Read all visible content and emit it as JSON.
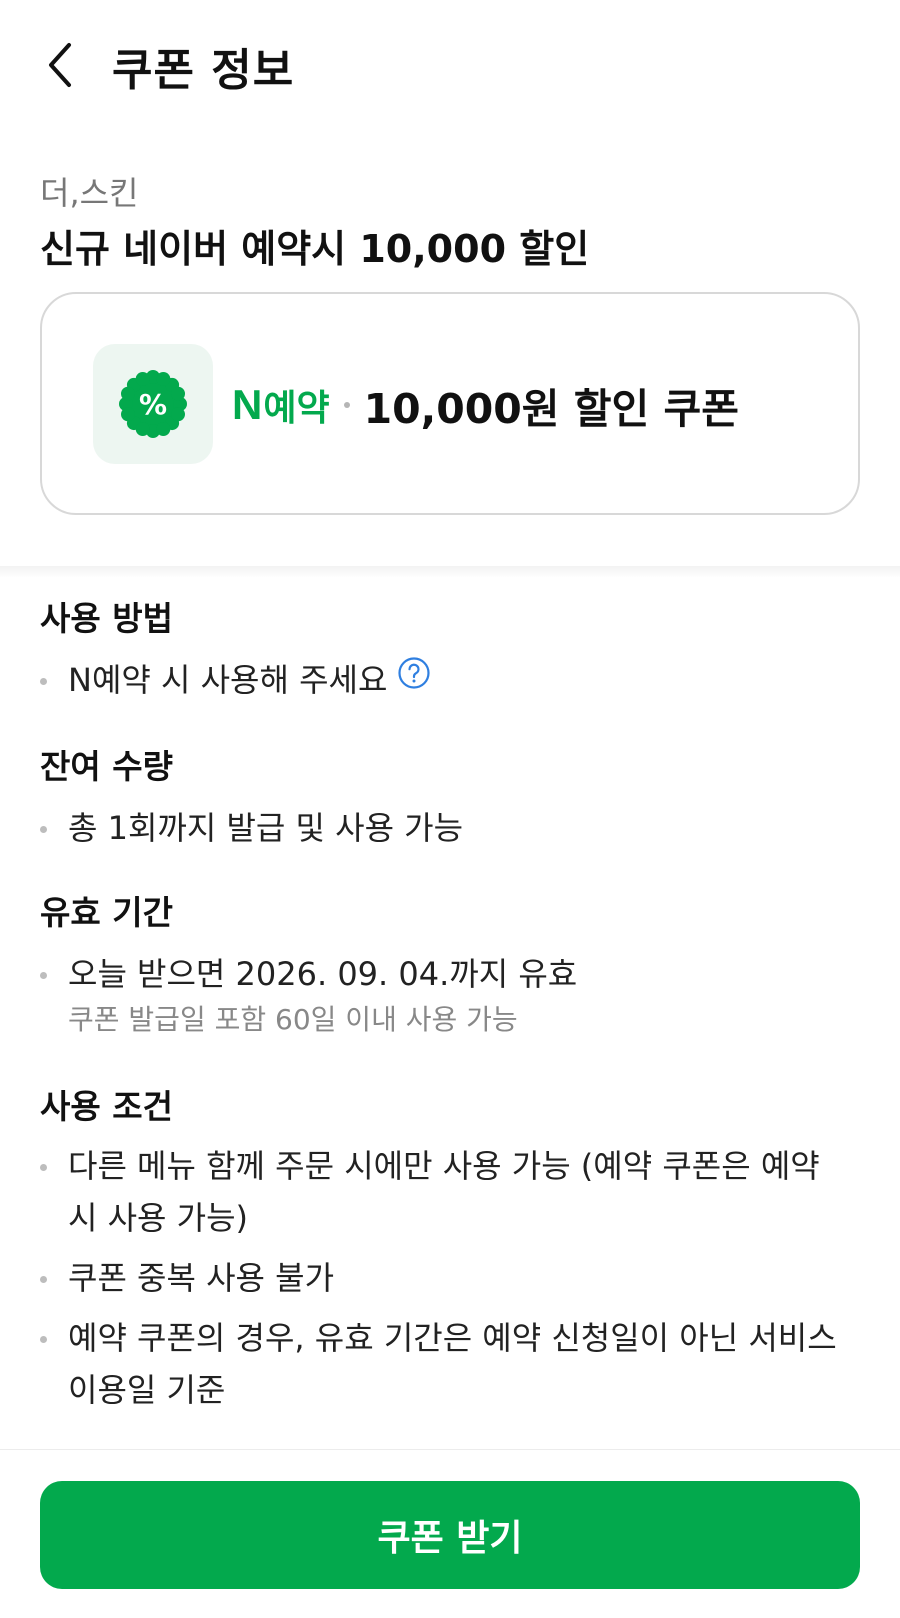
{
  "header": {
    "title": "쿠폰 정보"
  },
  "store": {
    "name": "더,스킨"
  },
  "coupon": {
    "title": "신규 네이버 예약시 10,000 할인",
    "card": {
      "icon_symbol": "%",
      "logo_n": "N",
      "logo_text": "예약",
      "label": "10,000원 할인 쿠폰"
    }
  },
  "sections": {
    "usage": {
      "title": "사용 방법",
      "items": [
        "N예약 시 사용해 주세요"
      ]
    },
    "quantity": {
      "title": "잔여 수량",
      "items": [
        "총 1회까지 발급 및 사용 가능"
      ]
    },
    "validity": {
      "title": "유효 기간",
      "items": [
        "오늘 받으면 2026. 09. 04.까지 유효"
      ],
      "note": "쿠폰 발급일 포함 60일 이내 사용 가능"
    },
    "conditions": {
      "title": "사용 조건",
      "items": [
        "다른 메뉴 함께 주문 시에만 사용 가능 (예약 쿠폰은 예약 시 사용 가능)",
        "쿠폰 중복 사용 불가",
        "예약 쿠폰의 경우, 유효 기간은 예약 신청일이 아닌 서비스 이용일 기준"
      ]
    }
  },
  "cta": {
    "label": "쿠폰 받기"
  },
  "colors": {
    "accent": "#03a94d",
    "icon_bg": "#edf6f1",
    "help": "#2f7fe0"
  }
}
